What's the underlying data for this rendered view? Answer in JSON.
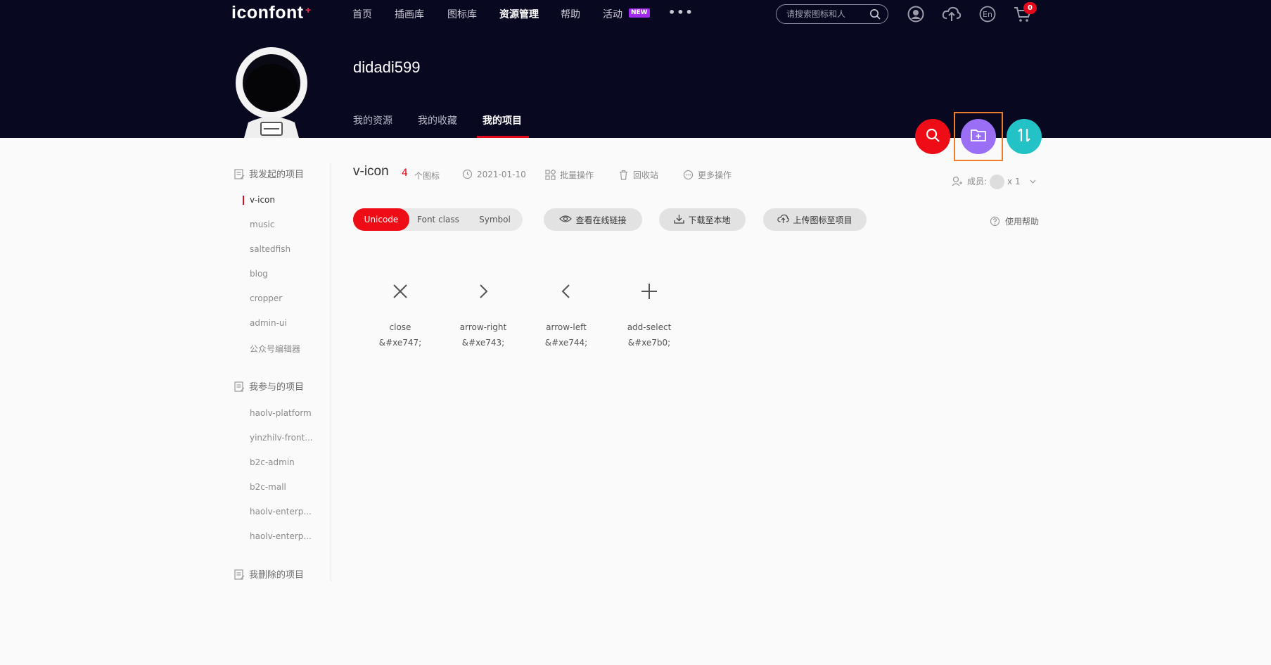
{
  "brand": {
    "logo_text": "iconfont",
    "logo_mark": "+"
  },
  "nav": {
    "items": [
      "首页",
      "插画库",
      "图标库",
      "资源管理",
      "帮助",
      "活动"
    ],
    "active": "资源管理",
    "new_badge": "NEW",
    "more": "•••"
  },
  "search": {
    "placeholder": "请搜索图标和人"
  },
  "header_icons": [
    "user-icon",
    "upload-icon",
    "language-en-icon",
    "cart-icon"
  ],
  "cart": {
    "count": "0"
  },
  "profile": {
    "username": "didadi599"
  },
  "profile_tabs": {
    "items": [
      "我的资源",
      "我的收藏",
      "我的项目"
    ],
    "active": "我的项目"
  },
  "fab": [
    "search-icon",
    "add-folder-icon",
    "sort-icon"
  ],
  "sidebar": {
    "created_title": "我发起的项目",
    "created": [
      "v-icon",
      "music",
      "saltedfish",
      "blog",
      "cropper",
      "admin-ui",
      "公众号编辑器"
    ],
    "active_project": "v-icon",
    "joined_title": "我参与的项目",
    "joined": [
      "haolv-platform",
      "yinzhilv-front...",
      "b2c-admin",
      "b2c-mall",
      "haolv-enterp...",
      "haolv-enterp..."
    ],
    "deleted_title": "我删除的项目"
  },
  "project": {
    "name": "v-icon",
    "icon_count": "4",
    "icon_count_label": "个图标",
    "date": "2021-01-10",
    "batch": "批量操作",
    "recycle": "回收站",
    "more": "更多操作",
    "members_label": "成员:",
    "members_count": "x 1"
  },
  "toolbar": {
    "modes": [
      "Unicode",
      "Font class",
      "Symbol"
    ],
    "active_mode": "Unicode",
    "view_link": "查看在线链接",
    "download": "下载至本地",
    "upload": "上传图标至项目",
    "help": "使用帮助"
  },
  "icons": [
    {
      "name": "close",
      "code": "&#xe747;",
      "glyph": "close-icon"
    },
    {
      "name": "arrow-right",
      "code": "&#xe743;",
      "glyph": "arrow-right-icon"
    },
    {
      "name": "arrow-left",
      "code": "&#xe744;",
      "glyph": "arrow-left-icon"
    },
    {
      "name": "add-select",
      "code": "&#xe7b0;",
      "glyph": "plus-icon"
    }
  ],
  "colors": {
    "header_bg": "#080821",
    "accent": "#e3081b",
    "fab_search": "#ee0d16",
    "fab_add": "#9a6ff5",
    "fab_sort": "#22c2c6",
    "highlight": "#ef7d2a"
  }
}
